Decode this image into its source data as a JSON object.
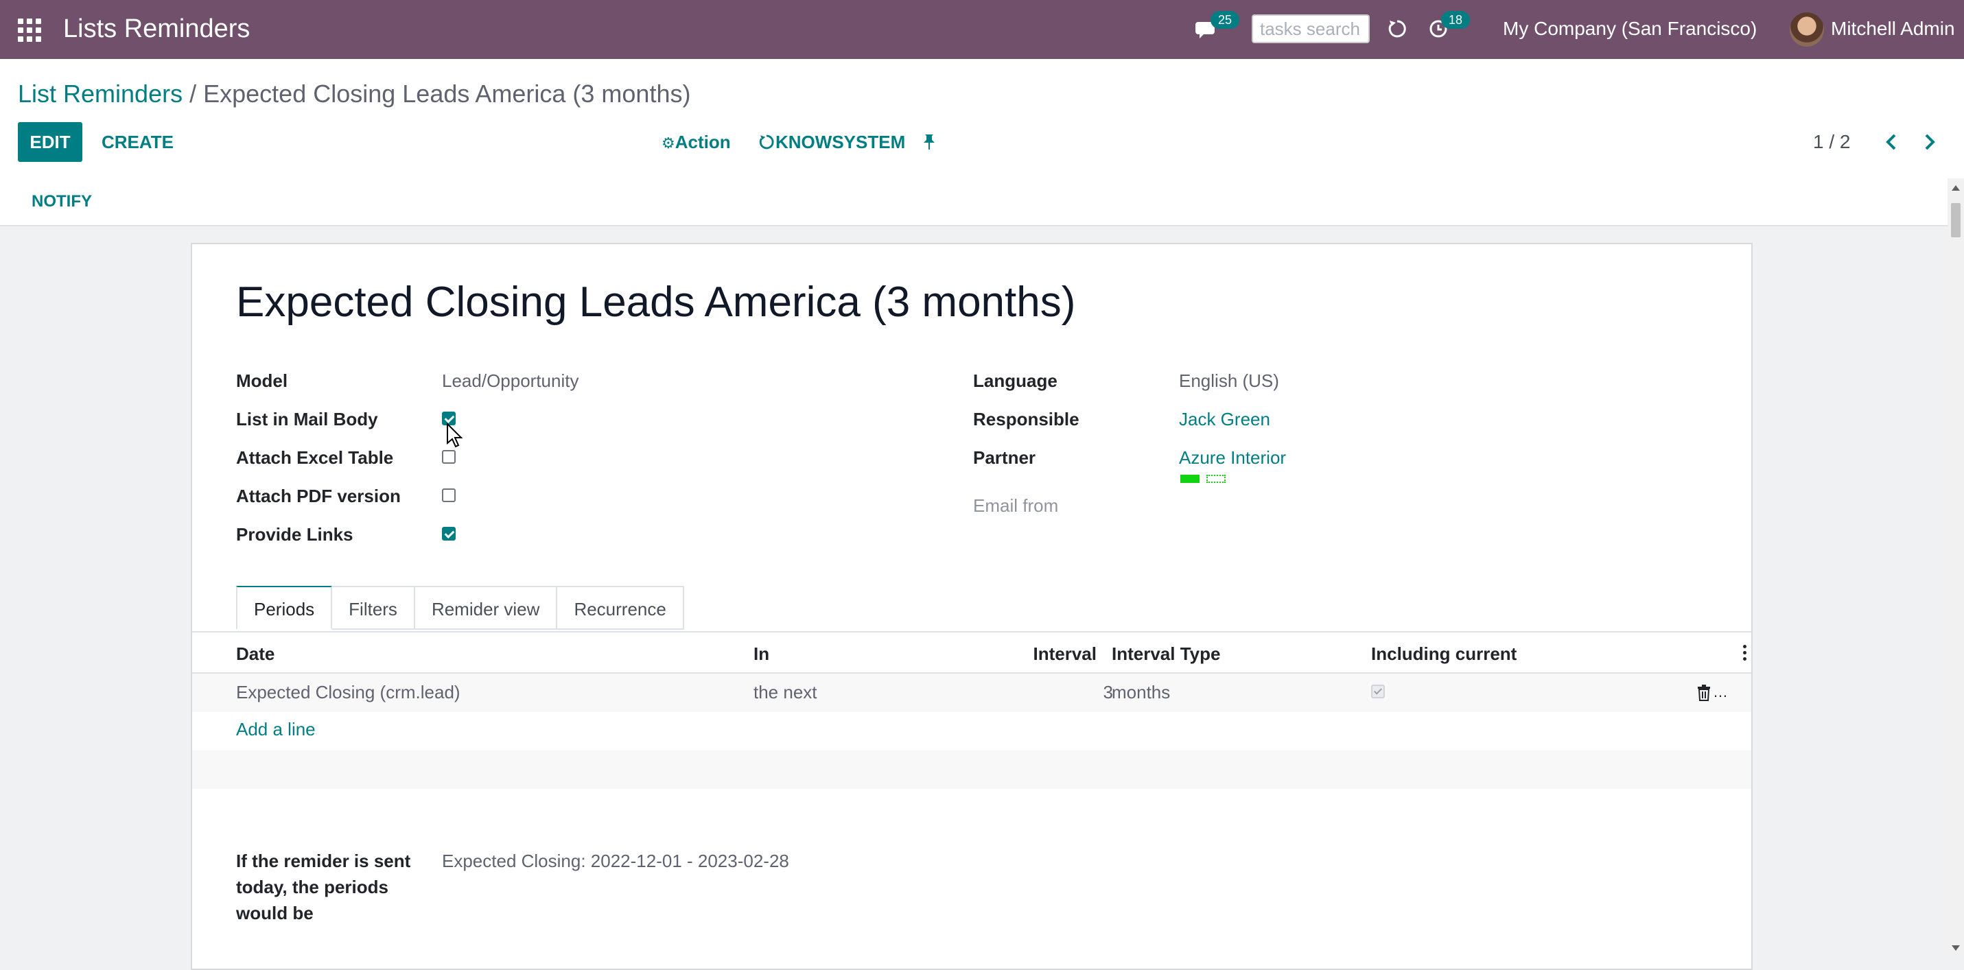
{
  "app": {
    "title": "Lists Reminders"
  },
  "navbar": {
    "messages_count": "25",
    "search_placeholder": "tasks search",
    "activities_count": "18",
    "company": "My Company (San Francisco)",
    "user": "Mitchell Admin"
  },
  "breadcrumb": {
    "parent": "List Reminders",
    "separator": " / ",
    "current": "Expected Closing Leads America (3 months)"
  },
  "toolbar": {
    "edit_label": "EDIT",
    "create_label": "CREATE",
    "action_label": "Action",
    "knowsystem_label": "KNOWSYSTEM",
    "pager": "1 / 2"
  },
  "statusbar": {
    "notify_label": "NOTIFY"
  },
  "record": {
    "title": "Expected Closing Leads America (3 months)",
    "left_fields": [
      {
        "label": "Model",
        "value": "Lead/Opportunity"
      },
      {
        "label": "List in Mail Body",
        "checked": true
      },
      {
        "label": "Attach Excel Table",
        "checked": false
      },
      {
        "label": "Attach PDF version",
        "checked": false
      },
      {
        "label": "Provide Links",
        "checked": true
      }
    ],
    "right_fields": [
      {
        "label": "Language",
        "value": "English (US)"
      },
      {
        "label": "Responsible",
        "value": "Jack Green"
      },
      {
        "label": "Partner",
        "value": "Azure Interior"
      },
      {
        "label": "Email from",
        "value": ""
      }
    ]
  },
  "tabs": [
    "Periods",
    "Filters",
    "Remider view",
    "Recurrence"
  ],
  "table": {
    "columns": [
      "Date",
      "In",
      "Interval",
      "Interval Type",
      "Including current"
    ],
    "rows": [
      {
        "date": "Expected Closing (crm.lead)",
        "in": "the next",
        "interval": "3",
        "interval_type": "months",
        "including_current": true
      }
    ],
    "add_line_label": "Add a line"
  },
  "preview": {
    "label": "If the remider is sent today, the periods would be",
    "value": "Expected Closing: 2022-12-01 - 2023-02-28"
  },
  "colors": {
    "brand": "#71506b",
    "accent": "#017e84",
    "partner_tag": "#12d312"
  }
}
